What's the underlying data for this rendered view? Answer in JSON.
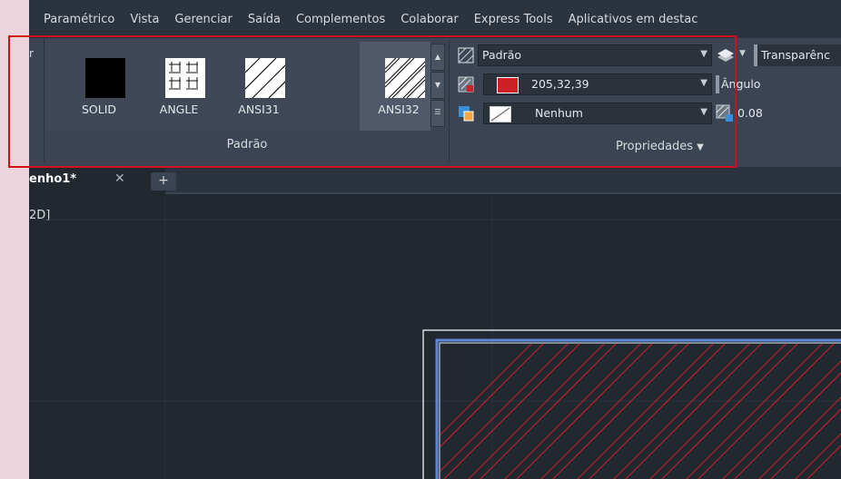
{
  "menu": [
    "Paramétrico",
    "Vista",
    "Gerenciar",
    "Saída",
    "Complementos",
    "Colaborar",
    "Express Tools",
    "Aplicativos em destac"
  ],
  "ribbon": {
    "left_stub_label": "r",
    "pattern_panel": {
      "title": "Padrão",
      "patterns": [
        {
          "label": "SOLID",
          "icon": "solid-fill-icon"
        },
        {
          "label": "ANGLE",
          "icon": "angle-grid-icon"
        },
        {
          "label": "ANSI31",
          "icon": "ansi31-hatch-icon"
        },
        {
          "label": "ANSI32",
          "icon": "ansi32-hatch-icon"
        }
      ],
      "selected": "ANSI32"
    },
    "properties_panel": {
      "title": "Propriedades",
      "pattern_type": "Padrão",
      "color_value": "205,32,39",
      "color_hex": "#cd2027",
      "background": "Nenhum",
      "transparency_label": "Transparênc",
      "angle_label": "Ângulo",
      "scale_value": "0.08"
    }
  },
  "tabs": {
    "document": "enho1*",
    "close_glyph": "✕",
    "add_glyph": "+"
  },
  "drawing": {
    "view_label": "2D]",
    "hatch_color": "#cd2027"
  }
}
